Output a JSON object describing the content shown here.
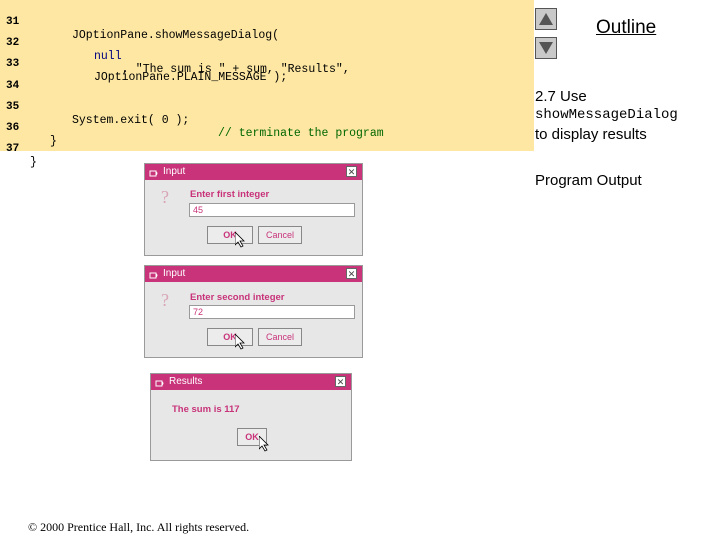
{
  "code_lines": [
    {
      "num": "31",
      "text": "JOptionPane.showMessageDialog("
    },
    {
      "num": "32",
      "pre": "null",
      "text": ", \"The sum is \" + sum, \"Results\","
    },
    {
      "num": "33",
      "text": "JOptionPane.PLAIN_MESSAGE );"
    },
    {
      "num": "34",
      "text": ""
    },
    {
      "num": "35",
      "text": "System.exit( 0 );",
      "comment": "// terminate the program"
    },
    {
      "num": "36",
      "text": "}"
    },
    {
      "num": "37",
      "text": "}"
    }
  ],
  "sidebar": {
    "outline_label": "Outline",
    "title_prefix": "2.7 Use",
    "title_method": "showMessageDialog",
    "title_suffix": "to display results",
    "program_output": "Program Output"
  },
  "dialogs": {
    "input1": {
      "title": "Input",
      "prompt": "Enter first integer",
      "value": "45",
      "ok": "OK",
      "cancel": "Cancel"
    },
    "input2": {
      "title": "Input",
      "prompt": "Enter second integer",
      "value": "72",
      "ok": "OK",
      "cancel": "Cancel"
    },
    "results": {
      "title": "Results",
      "message": "The sum is 117",
      "ok": "OK"
    }
  },
  "copyright": "© 2000 Prentice Hall, Inc.  All rights reserved.",
  "colors": {
    "code_bg": "#fde7a3",
    "titlebar": "#c8337a",
    "accent_text": "#c8337a"
  }
}
